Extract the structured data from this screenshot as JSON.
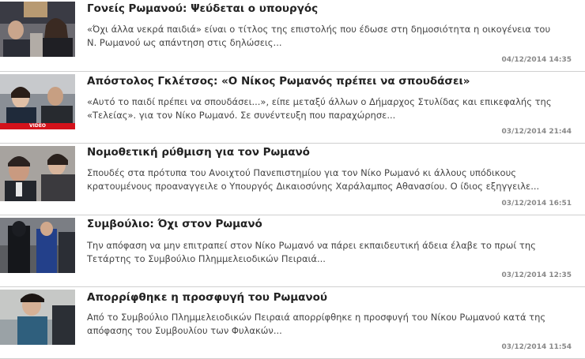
{
  "articles": [
    {
      "title": "Γονείς Ρωμανού: Ψεύδεται ο υπουργός",
      "summary": "«Όχι άλλα νεκρά παιδιά» είναι ο τίτλος της επιστολής που έδωσε στη δημοσιότητα η οικογένεια του Ν. Ρωμανού ως απάντηση στις δηλώσεις...",
      "date": "04/12/2014 14:35"
    },
    {
      "title": "Απόστολος Γκλέτσος: «Ο Νίκος Ρωμανός πρέπει να σπουδάσει»",
      "summary": "«Αυτό το παιδί πρέπει να σπουδάσει...», είπε μεταξύ άλλων ο Δήμαρχος Στυλίδας και επικεφαλής της «Τελείας». για τον Νίκο Ρωμανό. Σε συνέντευξη που παραχώρησε...",
      "date": "03/12/2014 21:44",
      "badge": "VIDEO"
    },
    {
      "title": "Νομοθετική ρύθμιση για τον Ρωμανό",
      "summary": "Σπουδές στα πρότυπα του Ανοιχτού Πανεπιστημίου για τον Νίκο Ρωμανό κι άλλους υπόδικους κρατουμένους προαναγγειλε ο Υπουργός Δικαιοσύνης Χαράλαμπος Αθανασίου. Ο ίδιος εξηγγειλε...",
      "date": "03/12/2014 16:51"
    },
    {
      "title": "Συμβούλιο: Όχι στον Ρωμανό",
      "summary": "Την απόφαση να μην επιτραπεί στον Νίκο Ρωμανό να πάρει εκπαιδευτική άδεια έλαβε το πρωί της Τετάρτης το Συμβούλιο Πλημμελειοδικών Πειραιά...",
      "date": "03/12/2014 12:35"
    },
    {
      "title": "Απορρίφθηκε η προσφυγή του Ρωμανού",
      "summary": "Από το Συμβούλιο Πλημμελειοδικών Πειραιά απορρίφθηκε η προσφυγή του Νίκου Ρωμανού κατά της απόφασης του Συμβουλίου των Φυλακών...",
      "date": "03/12/2014 11:54"
    }
  ]
}
